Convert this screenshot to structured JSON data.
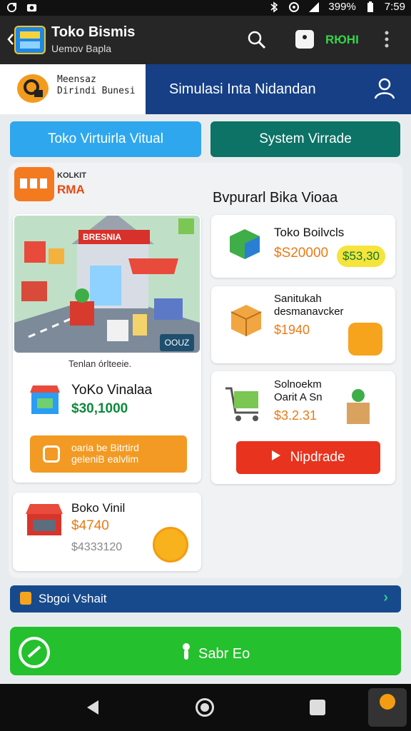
{
  "status_bar": {
    "battery": "399%",
    "time": "7:59"
  },
  "app_bar": {
    "title": "Toko Bismis",
    "subtitle": "Uemov Bapla",
    "room_label": "RЮHI"
  },
  "banner": {
    "left_line1": "Meensaz",
    "left_line2": "Dirindi Bunesi",
    "title": "Simulasi Inta Nidandan"
  },
  "buttons": {
    "virtual": "Toko Virtuirla Vitual",
    "system": "System Virrade"
  },
  "store_card": {
    "badge_line1": "KOLKIT",
    "badge_line2": "RMA",
    "sign": "BRESNIA",
    "illus_tag": "OOUZ",
    "caption": "Tenlan órlteeie.",
    "name": "YoKo Vinalaa",
    "price": "$30,1000",
    "action": [
      "oaria be Bitrtird",
      "geleniB ealvlim"
    ]
  },
  "section_title": "Bvpurarl Bika Vioaa",
  "items": [
    {
      "name": "Toko Boilvcls",
      "price": "$S20000",
      "pill": "$53,30"
    },
    {
      "name": [
        "Sanitukah",
        "desmanavcker"
      ],
      "price": "$1940"
    },
    {
      "name": [
        "Solnoekm",
        "Oarit A Sn"
      ],
      "price": "$3.2.31",
      "action": "Nipdrade"
    },
    {
      "name": "Boko Vinil",
      "price": "$4740",
      "old_price": "$4333120"
    }
  ],
  "info_bar": {
    "label": "Sbgoi Vshait"
  },
  "start_button": {
    "label": "Sabr Eo"
  },
  "colors": {
    "primary_blue": "#163f86",
    "accent_green": "#25c02e",
    "accent_orange": "#f29a23",
    "upgrade_red": "#e8331e"
  }
}
